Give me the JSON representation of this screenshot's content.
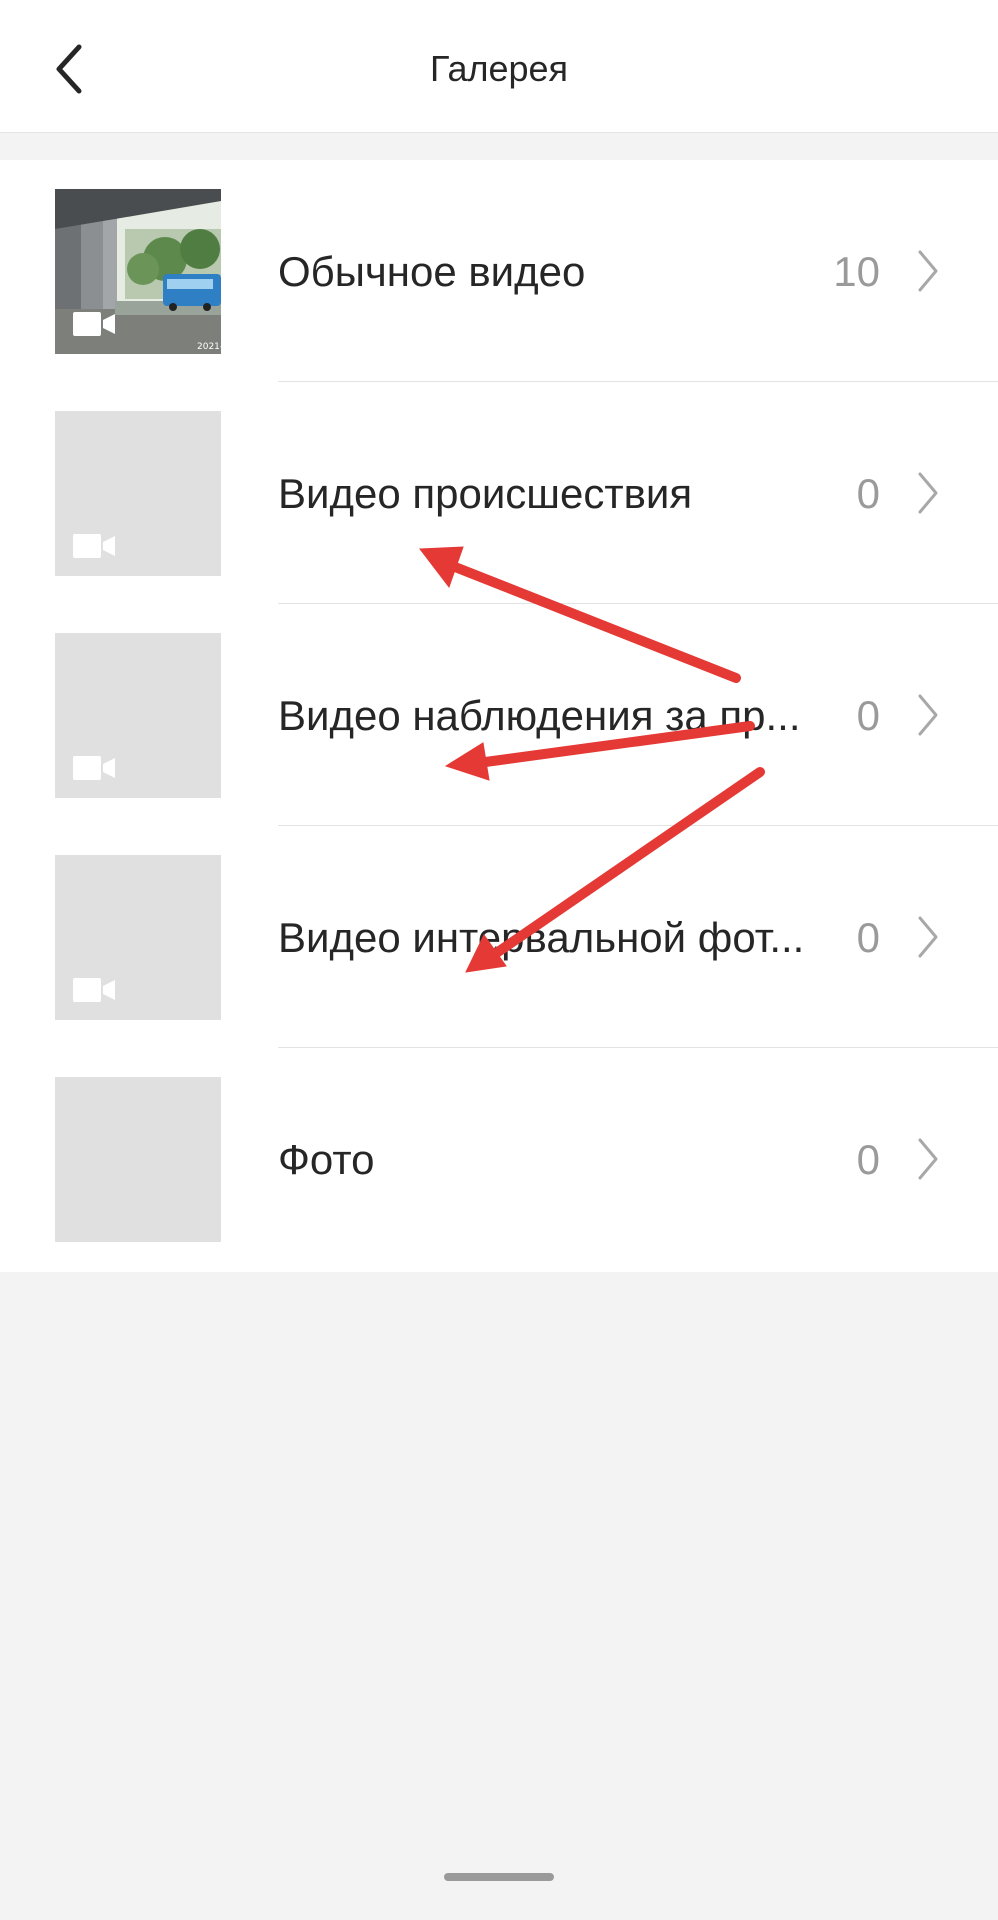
{
  "header": {
    "title": "Галерея",
    "back_icon": "chevron-left-icon"
  },
  "gallery": {
    "items": [
      {
        "label": "Обычное видео",
        "count": "10",
        "has_thumbnail_image": true,
        "icon": "video-camera-icon",
        "thumb_caption": "2021-"
      },
      {
        "label": "Видео происшествия",
        "count": "0",
        "has_thumbnail_image": false,
        "icon": "video-camera-icon"
      },
      {
        "label": "Видео наблюдения за пр...",
        "count": "0",
        "has_thumbnail_image": false,
        "icon": "video-camera-icon"
      },
      {
        "label": "Видео интервальной фот...",
        "count": "0",
        "has_thumbnail_image": false,
        "icon": "video-camera-icon"
      },
      {
        "label": "Фото",
        "count": "0",
        "has_thumbnail_image": false,
        "icon": null
      }
    ]
  },
  "annotation_color": "#e53935",
  "colors": {
    "text_primary": "#262626",
    "text_secondary": "#9a9a9a",
    "background": "#f3f3f3",
    "placeholder": "#e0e0e0"
  }
}
